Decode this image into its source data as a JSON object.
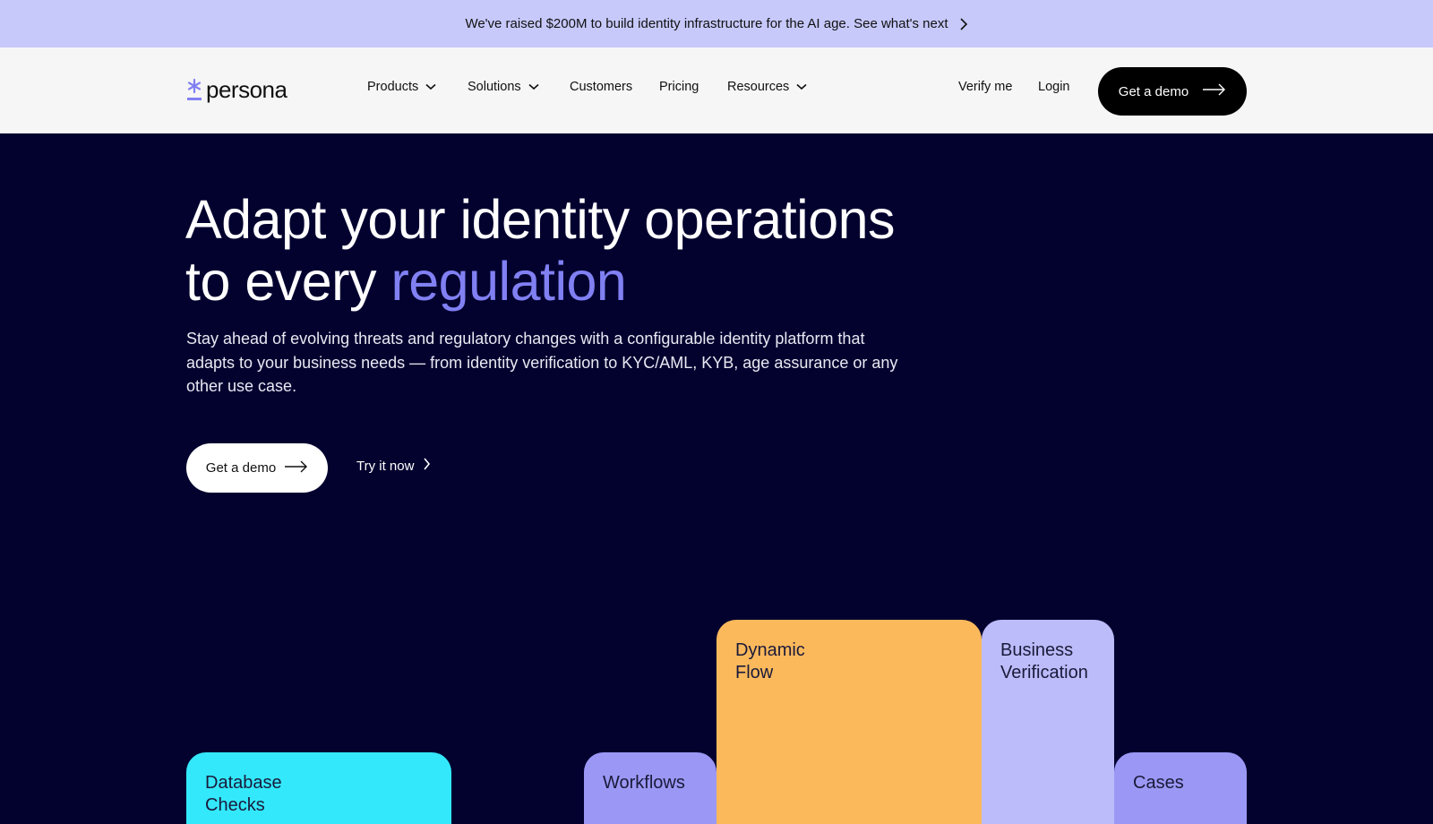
{
  "announcement": {
    "text": "We've raised $200M to build identity infrastructure for the AI age. See what's next"
  },
  "nav": {
    "logo_text": "persona",
    "items": [
      {
        "label": "Products",
        "has_dropdown": true
      },
      {
        "label": "Solutions",
        "has_dropdown": true
      },
      {
        "label": "Customers",
        "has_dropdown": false
      },
      {
        "label": "Pricing",
        "has_dropdown": false
      },
      {
        "label": "Resources",
        "has_dropdown": true
      }
    ],
    "verify_label": "Verify me",
    "login_label": "Login",
    "demo_label": "Get a demo"
  },
  "hero": {
    "title_line1": "Adapt your identity operations",
    "title_line2_plain": "to every ",
    "title_line2_accent": "regulation",
    "subtitle": "Stay ahead of evolving threats and regulatory changes with a configurable identity platform that adapts to your business needs — from identity verification to KYC/AML, KYB, age assurance or any other use case.",
    "demo_label": "Get a demo",
    "try_label": "Try it now"
  },
  "cards": {
    "database_checks": "Database Checks",
    "workflows": "Workflows",
    "dynamic_flow": "Dynamic Flow",
    "business_verification": "Business Verification",
    "cases": "Cases"
  },
  "colors": {
    "announcement_bg": "#c7c9fb",
    "hero_bg": "#03022f",
    "accent": "#8180f3",
    "card_cyan": "#33e8fb",
    "card_violet": "#9b98f5",
    "card_orange": "#fcb95c",
    "card_lavender": "#bcbcfb"
  },
  "icons": {
    "announcement_arrow": "chevron-right-icon",
    "logo_mark": "asterisk-icon",
    "dropdown": "chevron-down-icon",
    "cta_arrow": "arrow-right-icon"
  }
}
